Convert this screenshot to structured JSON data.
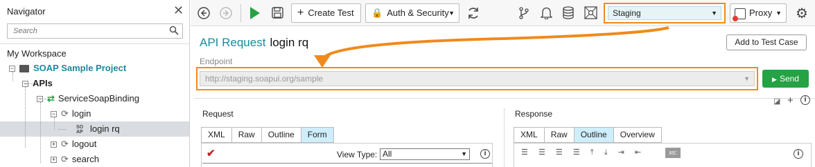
{
  "navigator": {
    "title": "Navigator",
    "search_placeholder": "Search",
    "workspace": "My Workspace",
    "tree": [
      {
        "label": "SOAP Sample Project"
      },
      {
        "label": "APIs"
      },
      {
        "label": "ServiceSoapBinding"
      },
      {
        "label": "login"
      },
      {
        "label": "login rq",
        "prefix": "SO AP"
      },
      {
        "label": "logout"
      },
      {
        "label": "search"
      }
    ]
  },
  "toolbar": {
    "create_test": "Create Test",
    "auth_security": "Auth & Security",
    "environment": "Staging",
    "proxy": "Proxy"
  },
  "request": {
    "title_type": "API Request",
    "title_name": "login rq",
    "add_to_test_case": "Add to Test Case",
    "endpoint_label": "Endpoint",
    "endpoint_value": "http://staging.soapui.org/sample",
    "send": "Send"
  },
  "request_pane": {
    "title": "Request",
    "tabs": [
      "XML",
      "Raw",
      "Outline",
      "Form"
    ],
    "active_tab": "Form",
    "view_type_label": "View Type:",
    "view_type_value": "All"
  },
  "response_pane": {
    "title": "Response",
    "tabs": [
      "XML",
      "Raw",
      "Outline",
      "Overview"
    ],
    "active_tab": "Outline",
    "xs_label": "xs:"
  },
  "colors": {
    "accent_teal": "#1a8a9c",
    "highlight_orange": "#f08a1c",
    "send_green": "#25a244",
    "active_tab": "#cfeefc"
  }
}
